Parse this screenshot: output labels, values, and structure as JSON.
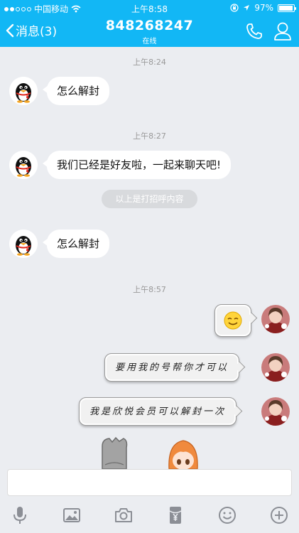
{
  "status_bar": {
    "carrier": "中国移动",
    "time": "上午8:58",
    "battery": "97%",
    "battery_level": 0.97
  },
  "nav": {
    "back_label": "消息(3)",
    "title": "848268247",
    "subtitle": "在线"
  },
  "messages": {
    "ts1": "上午8:24",
    "m1": "怎么解封",
    "ts2": "上午8:27",
    "m2": "我们已经是好友啦，一起来聊天吧!",
    "system": "以上是打招呼内容",
    "m3": "怎么解封",
    "ts3": "上午8:57",
    "m5": "要用我的号帮你才可以",
    "m6": "我是欣悦会员可以解封一次"
  },
  "input": {
    "placeholder": ""
  },
  "toolbar": {
    "icons": [
      "microphone-icon",
      "image-icon",
      "camera-icon",
      "red-packet-icon",
      "emoji-icon",
      "plus-icon"
    ]
  },
  "colors": {
    "brand": "#12b7f5",
    "background": "#ebedf1"
  }
}
